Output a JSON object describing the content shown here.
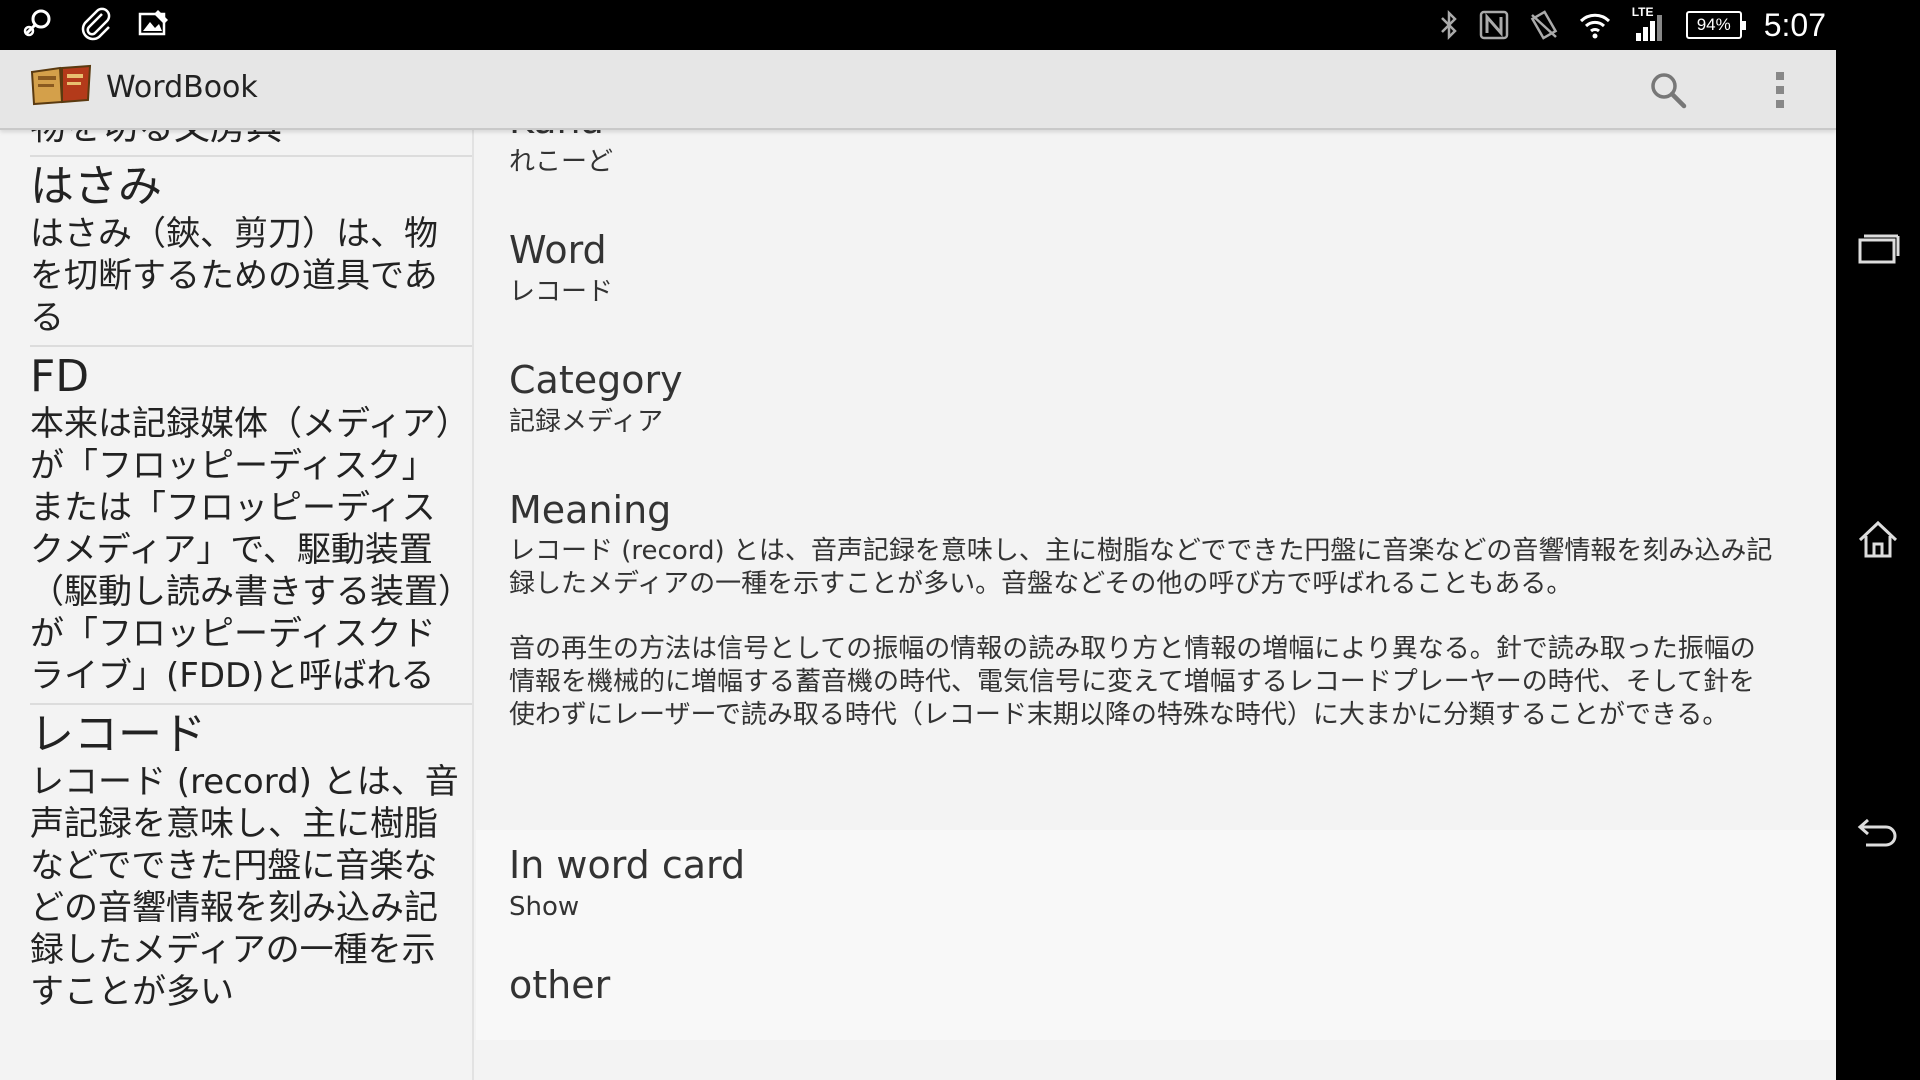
{
  "status_bar": {
    "time": "5:07",
    "battery": "94%",
    "network_label": "LTE",
    "left_icons": [
      "search-key-icon",
      "attachment-icon",
      "image-edit-icon"
    ],
    "right_icons": [
      "bluetooth-icon",
      "nfc-icon",
      "vibrate-icon",
      "wifi-icon",
      "signal-icon"
    ]
  },
  "action_bar": {
    "title": "WordBook",
    "actions": [
      "search-icon",
      "overflow-menu-icon"
    ]
  },
  "word_list": {
    "partial_top_text": "物を切る文房具",
    "items": [
      {
        "word": "はさみ",
        "definition": "はさみ（鋏、剪刀）は、物を切断するための道具である"
      },
      {
        "word": "FD",
        "definition": "本来は記録媒体（メディア）が「フロッピーディスク」または「フロッピーディスクメディア」で、駆動装置（駆動し読み書きする装置）が「フロッピーディスクドライブ」(FDD)と呼ばれる"
      },
      {
        "word": "レコード",
        "definition": "レコード (record) とは、音声記録を意味し、主に樹脂などでできた円盤に音楽などの音響情報を刻み込み記録したメディアの一種を示すことが多い"
      }
    ]
  },
  "detail": {
    "kana_label": "Kana",
    "kana_value": "れこーど",
    "word_label": "Word",
    "word_value": "レコード",
    "category_label": "Category",
    "category_value": "記録メディア",
    "meaning_label": "Meaning",
    "meaning_paragraphs": [
      "レコード (record) とは、音声記録を意味し、主に樹脂などでできた円盤に音楽などの音響情報を刻み込み記録したメディアの一種を示すことが多い。音盤などその他の呼び方で呼ばれることもある。",
      "音の再生の方法は信号としての振幅の情報の読み取り方と情報の増幅により異なる。針で読み取った振幅の情報を機械的に増幅する蓄音機の時代、電気信号に変えて増幅するレコードプレーヤーの時代、そして針を使わずにレーザーで読み取る時代（レコード末期以降の特殊な時代）に大まかに分類することができる。"
    ],
    "word_card_label": "In word card",
    "word_card_value": "Show",
    "other_label": "other"
  },
  "nav_bar": {
    "buttons": [
      "recent-apps-icon",
      "home-icon",
      "back-icon"
    ]
  }
}
